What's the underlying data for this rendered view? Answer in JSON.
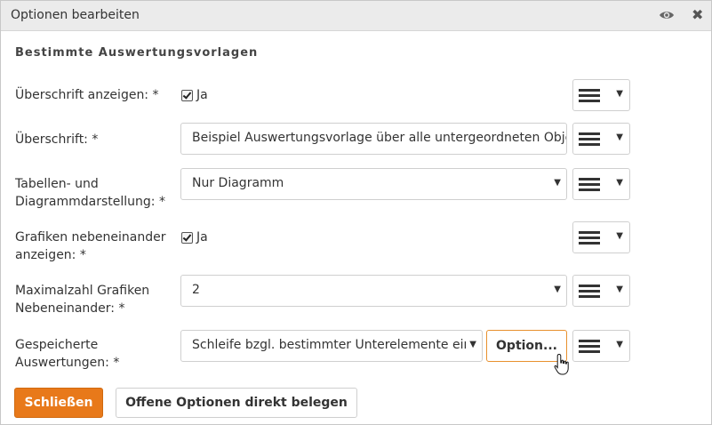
{
  "dialog": {
    "title": "Optionen bearbeiten",
    "icons": {
      "view": "eye-icon",
      "close": "close-icon"
    },
    "close_glyph": "✖"
  },
  "section": {
    "title": "Bestimmte Auswertungsvorlagen"
  },
  "rows": [
    {
      "label": "Überschrift anzeigen: *",
      "type": "checkbox",
      "checked": true,
      "value": "Ja"
    },
    {
      "label": "Überschrift: *",
      "type": "text",
      "value": "Beispiel Auswertungsvorlage über alle untergeordneten Obje"
    },
    {
      "label": "Tabellen- und Diagrammdarstellung: *",
      "type": "select",
      "value": "Nur Diagramm"
    },
    {
      "label": "Grafiken nebeneinander anzeigen: *",
      "type": "checkbox",
      "checked": true,
      "value": "Ja"
    },
    {
      "label": "Maximalzahl Grafiken Nebeneinander: *",
      "type": "select",
      "value": "2"
    },
    {
      "label": "Gespeicherte Auswertungen: *",
      "type": "select",
      "value": "Schleife bzgl. bestimmter Unterelemente eir",
      "button": "Option..."
    }
  ],
  "buttons": {
    "close": "Schließen",
    "fill_open": "Offene Optionen direkt belegen"
  },
  "glyphs": {
    "caret": "▼"
  },
  "colors": {
    "accent": "#e8791a",
    "option_border": "#e8912e",
    "titlebar": "#ebebeb"
  }
}
